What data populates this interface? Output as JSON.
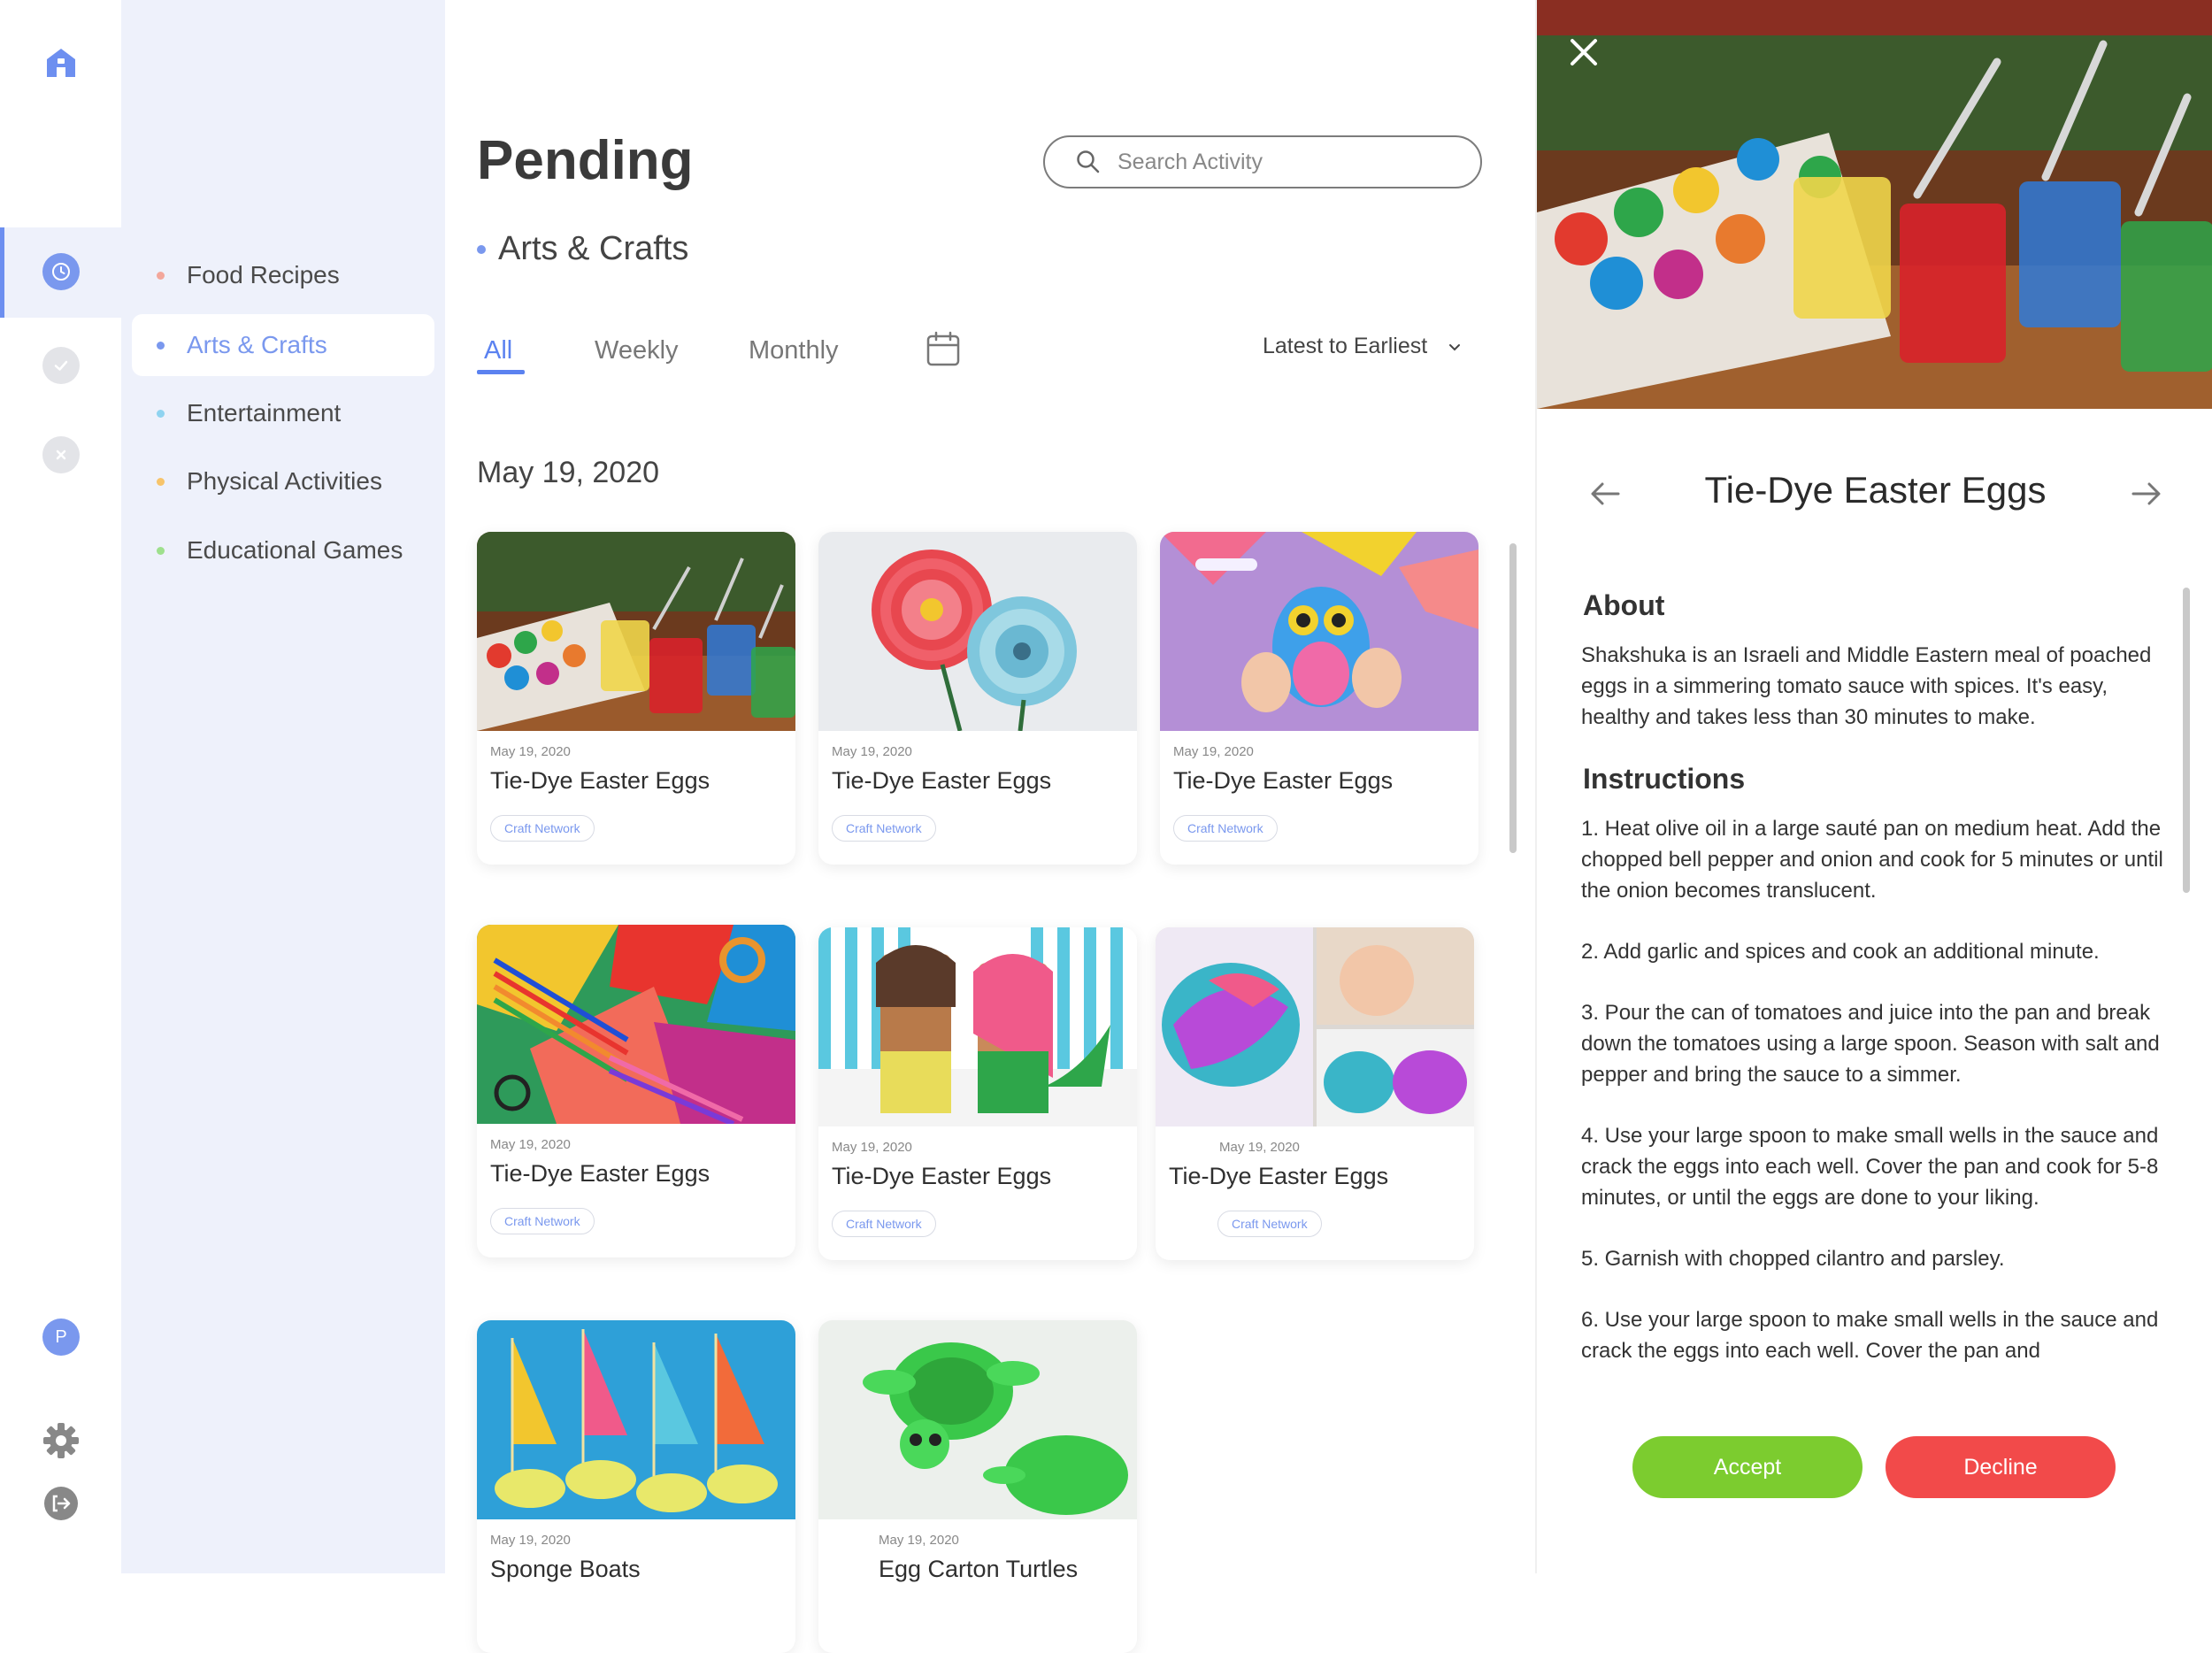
{
  "rail": {
    "avatar_initial": "P"
  },
  "categories": [
    {
      "label": "Food Recipes",
      "color": "#f3a79b",
      "active": false
    },
    {
      "label": "Arts & Crafts",
      "color": "#7a98ee",
      "active": true
    },
    {
      "label": "Entertainment",
      "color": "#8fd3f0",
      "active": false
    },
    {
      "label": "Physical Activities",
      "color": "#f7c46a",
      "active": false
    },
    {
      "label": "Educational Games",
      "color": "#9ee08d",
      "active": false
    }
  ],
  "main": {
    "title": "Pending",
    "subtitle": "Arts & Crafts",
    "search_placeholder": "Search Activity",
    "tabs": [
      {
        "label": "All",
        "active": true
      },
      {
        "label": "Weekly",
        "active": false
      },
      {
        "label": "Monthly",
        "active": false
      }
    ],
    "sort_label": "Latest to Earliest",
    "date_heading": "May 19, 2020",
    "cards": [
      {
        "date": "May 19, 2020",
        "title": "Tie-Dye Easter Eggs",
        "tag": "Craft Network",
        "image": "dye-eggs-photo"
      },
      {
        "date": "May 19, 2020",
        "title": "Tie-Dye Easter Eggs",
        "tag": "Craft Network",
        "image": "paper-flowers-photo"
      },
      {
        "date": "May 19, 2020",
        "title": "Tie-Dye Easter Eggs",
        "tag": "Craft Network",
        "image": "paper-owl-photo"
      },
      {
        "date": "May 19, 2020",
        "title": "Tie-Dye Easter Eggs",
        "tag": "Craft Network",
        "image": "craft-supplies-photo"
      },
      {
        "date": "May 19, 2020",
        "title": "Tie-Dye Easter Eggs",
        "tag": "Craft Network",
        "image": "paper-roll-dolls-photo"
      },
      {
        "date": "May 19, 2020",
        "title": "Tie-Dye Easter Eggs",
        "tag": "Craft Network",
        "image": "play-dough-photo"
      },
      {
        "date": "May 19, 2020",
        "title": "Sponge Boats",
        "tag": "",
        "image": "sponge-boats-photo"
      },
      {
        "date": "May 19, 2020",
        "title": "Egg Carton Turtles",
        "tag": "",
        "image": "egg-carton-turtles-photo"
      }
    ]
  },
  "detail": {
    "title": "Tie-Dye Easter Eggs",
    "about_heading": "About",
    "about_text": "Shakshuka is an Israeli and Middle Eastern meal of poached eggs in a simmering tomato sauce with spices. It's easy, healthy and takes less than 30 minutes to make.",
    "instructions_heading": "Instructions",
    "steps": [
      "1. Heat olive oil in a large sauté pan on medium heat. Add the chopped bell pepper and onion and cook for 5 minutes or until the onion becomes translucent.",
      "2. Add garlic and spices and cook an additional minute.",
      "3. Pour the can of tomatoes and juice into the pan and break down the tomatoes using a large spoon. Season with salt and pepper and bring the sauce to a simmer.",
      "4. Use your large spoon to make small wells in the sauce and crack the eggs into each well. Cover the pan and cook for 5-8 minutes, or until the eggs are done to your liking.",
      "5. Garnish with chopped cilantro and parsley.",
      "6. Use your large spoon to make small wells in the sauce and crack the eggs into each well. Cover the pan and"
    ],
    "accept_label": "Accept",
    "decline_label": "Decline"
  },
  "colors": {
    "accent": "#7a98ee",
    "accept": "#7ccc2f",
    "decline": "#f24a4a"
  }
}
